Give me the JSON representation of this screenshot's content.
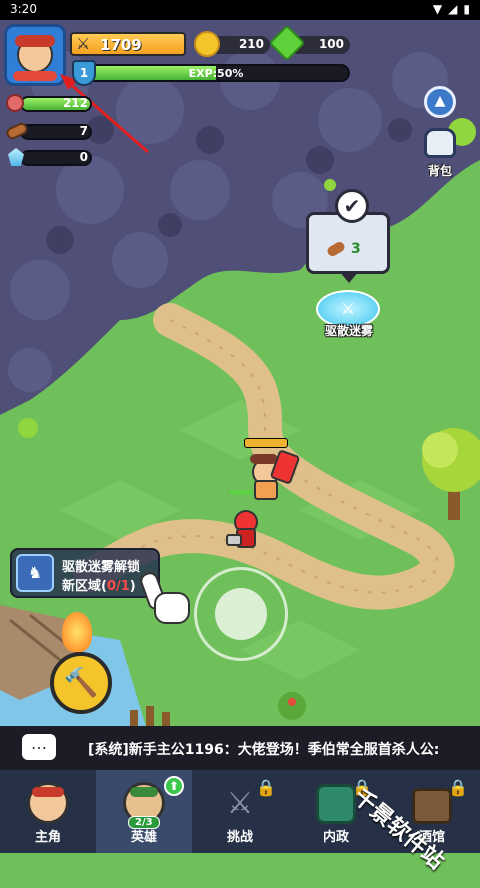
{
  "status_bar": {
    "time": "3:20"
  },
  "player": {
    "power": "1709",
    "gold": "210",
    "gems": "100",
    "level": "1",
    "exp_label": "EXP:50%",
    "exp_fraction": 0.5
  },
  "resources": [
    {
      "name": "meat",
      "value": "212",
      "fill": 1.0
    },
    {
      "name": "wood",
      "value": "7",
      "fill": 0.0
    },
    {
      "name": "crystal",
      "value": "0",
      "fill": 0.0
    }
  ],
  "right_panel": {
    "bag_label": "背包"
  },
  "fog_popup": {
    "cost": "3",
    "portal_label": "驱散迷雾"
  },
  "quest": {
    "line1": "驱散迷雾解锁",
    "line2_prefix": "新区域(",
    "progress": "0/1",
    "line2_suffix": ")"
  },
  "ticker": {
    "message": "[系统]新手主公1196：大佬登场！季伯常全服首杀人公:"
  },
  "nav": [
    {
      "label": "主角"
    },
    {
      "label": "英雄",
      "badge": "2/3"
    },
    {
      "label": "挑战"
    },
    {
      "label": "内政"
    },
    {
      "label": "酒馆"
    }
  ],
  "watermark": "千景软件站",
  "colors": {
    "grass": "#6fbf5a",
    "fog": "#4f4f78",
    "path": "#e0c08a",
    "exp": "#46b233",
    "nav": "#263147"
  }
}
